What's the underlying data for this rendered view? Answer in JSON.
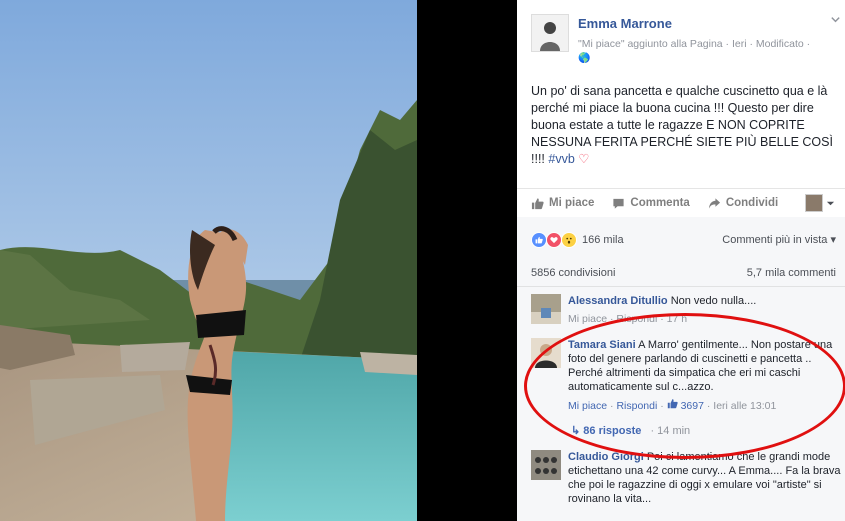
{
  "post": {
    "author": "Emma Marrone",
    "meta": "\"Mi piace\" aggiunto alla Pagina · Ieri · Modificato ·",
    "globe": "🌎",
    "text": "Un po' di sana pancetta e qualche cuscinetto qua e là perché mi piace la buona cucina !!! Questo per dire buona estate a tutte le ragazze E NON COPRITE NESSUNA FERITA PERCHÉ SIETE PIÙ BELLE COSÌ !!!! ",
    "hashtag": "#vvb",
    "heart": "♡"
  },
  "actions": {
    "like": "Mi piace",
    "comment": "Commenta",
    "share": "Condividi"
  },
  "reactions": {
    "count": "166 mila",
    "sort": "Commenti più in vista ▾",
    "shares": "5856 condivisioni",
    "comments": "5,7 mila commenti"
  },
  "comments": [
    {
      "name": "Alessandra Ditullio",
      "text": " Non vedo nulla....",
      "links": "Mi piace · Rispondi · 17 h"
    },
    {
      "name": "Tamara Siani",
      "text": " A Marro' gentilmente... Non postare una foto del genere parlando di cuscinetti e pancetta .. Perché altrimenti da simpatica che eri mi caschi automaticamente sul c...azzo.",
      "like": "Mi piace",
      "reply": "Rispondi",
      "likes": "3697",
      "time": "Ieri alle 13:01"
    },
    {
      "name": "Claudio Giorgi",
      "text": " Poi ci lamentiamo che le grandi mode etichettano una 42 come curvy... A Emma.... Fa la brava che poi le ragazzine di oggi x emulare voi \"artiste\" si rovinano la vita..."
    }
  ],
  "replies": {
    "label": "86 risposte",
    "time": "· 14 min"
  }
}
